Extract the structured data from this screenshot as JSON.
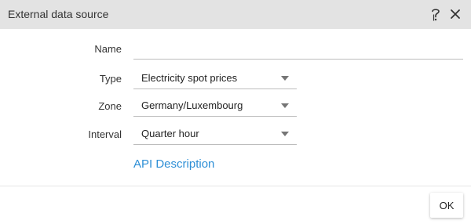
{
  "dialog": {
    "title": "External data source",
    "help_icon": "help-question-icon",
    "close_icon": "close-icon"
  },
  "form": {
    "name": {
      "label": "Name",
      "value": "",
      "placeholder": ""
    },
    "type": {
      "label": "Type",
      "value": "Electricity spot prices"
    },
    "zone": {
      "label": "Zone",
      "value": "Germany/Luxembourg"
    },
    "interval": {
      "label": "Interval",
      "value": "Quarter hour"
    },
    "dropdown_icon": "caret-down-icon"
  },
  "links": {
    "api_description": "API Description"
  },
  "footer": {
    "ok_label": "OK"
  },
  "colors": {
    "titlebar": "#e3e3e3",
    "link": "#2e8fd6",
    "underline": "#bdbdbd"
  }
}
